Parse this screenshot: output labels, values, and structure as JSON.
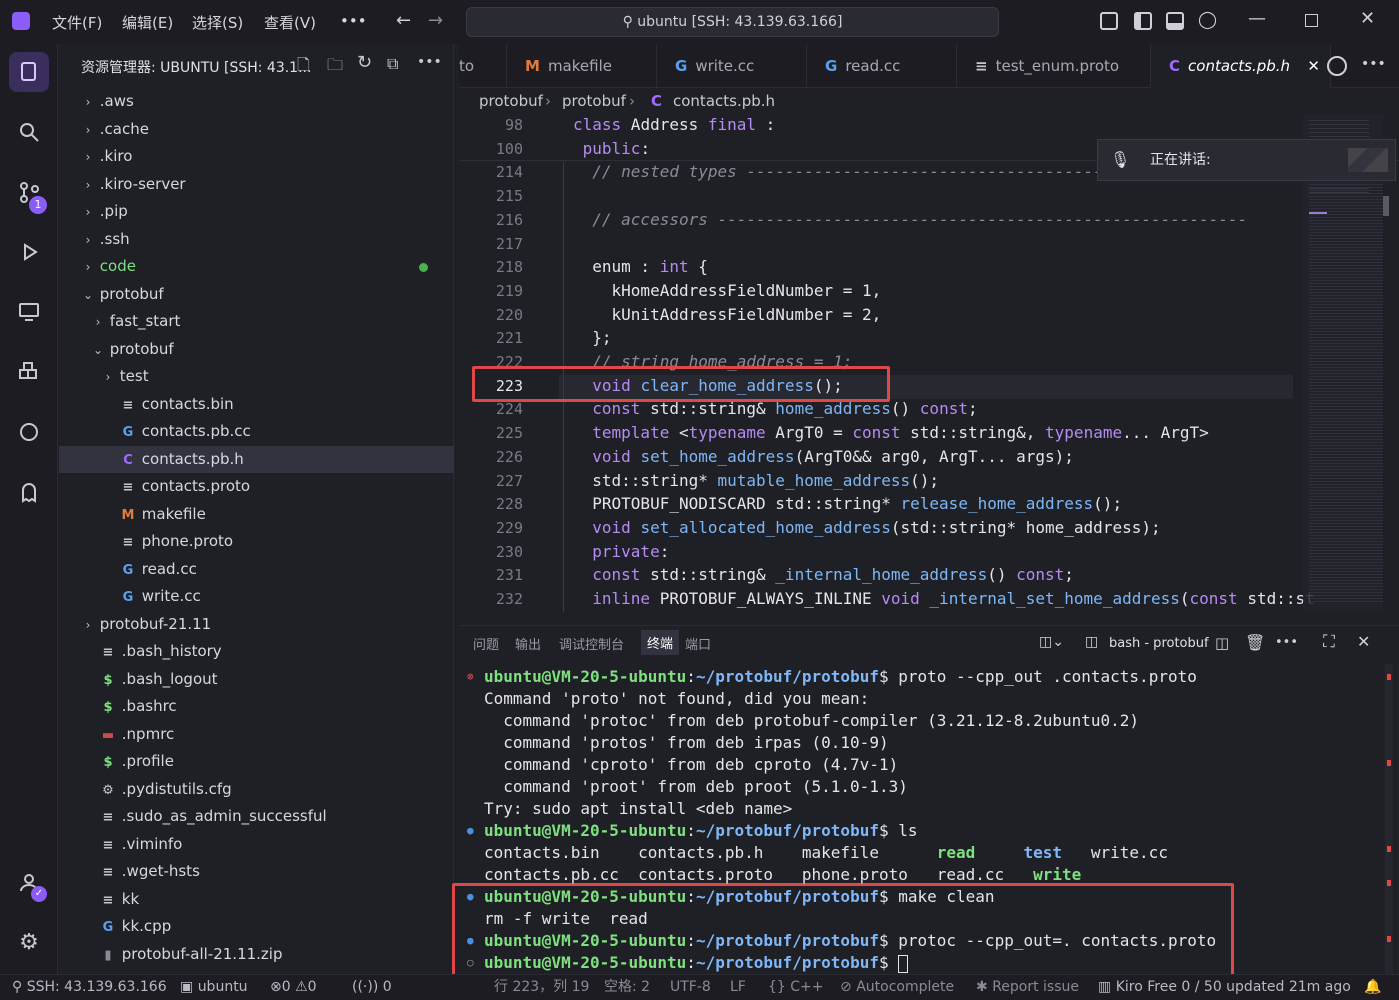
{
  "titlebar": {
    "menus": [
      "文件(F)",
      "编辑(E)",
      "选择(S)",
      "查看(V)",
      "•••"
    ],
    "command_center": "ubuntu [SSH: 43.139.63.166]"
  },
  "activity_badge": "1",
  "sidebar": {
    "title": "资源管理器: UBUNTU [SSH: 43.1...",
    "tree": [
      {
        "label": ".aws",
        "type": "folder",
        "depth": 0
      },
      {
        "label": ".cache",
        "type": "folder",
        "depth": 0
      },
      {
        "label": ".kiro",
        "type": "folder",
        "depth": 0
      },
      {
        "label": ".kiro-server",
        "type": "folder",
        "depth": 0
      },
      {
        "label": ".pip",
        "type": "folder",
        "depth": 0
      },
      {
        "label": ".ssh",
        "type": "folder",
        "depth": 0
      },
      {
        "label": "code",
        "type": "folder",
        "depth": 0,
        "modified": true
      },
      {
        "label": "protobuf",
        "type": "folder-open",
        "depth": 0
      },
      {
        "label": "fast_start",
        "type": "folder",
        "depth": 1
      },
      {
        "label": "protobuf",
        "type": "folder-open",
        "depth": 1
      },
      {
        "label": "test",
        "type": "folder",
        "depth": 2
      },
      {
        "label": "contacts.bin",
        "type": "text",
        "depth": 2
      },
      {
        "label": "contacts.pb.cc",
        "type": "cpp",
        "depth": 2
      },
      {
        "label": "contacts.pb.h",
        "type": "c",
        "depth": 2,
        "selected": true
      },
      {
        "label": "contacts.proto",
        "type": "text",
        "depth": 2
      },
      {
        "label": "makefile",
        "type": "make",
        "depth": 2
      },
      {
        "label": "phone.proto",
        "type": "text",
        "depth": 2
      },
      {
        "label": "read.cc",
        "type": "cpp",
        "depth": 2
      },
      {
        "label": "write.cc",
        "type": "cpp",
        "depth": 2
      },
      {
        "label": "protobuf-21.11",
        "type": "folder",
        "depth": 0
      },
      {
        "label": ".bash_history",
        "type": "text",
        "depth": 0
      },
      {
        "label": ".bash_logout",
        "type": "shell",
        "depth": 0
      },
      {
        "label": ".bashrc",
        "type": "shell",
        "depth": 0
      },
      {
        "label": ".npmrc",
        "type": "npm",
        "depth": 0
      },
      {
        "label": ".profile",
        "type": "shell",
        "depth": 0
      },
      {
        "label": ".pydistutils.cfg",
        "type": "gear",
        "depth": 0
      },
      {
        "label": ".sudo_as_admin_successful",
        "type": "text",
        "depth": 0
      },
      {
        "label": ".viminfo",
        "type": "text",
        "depth": 0
      },
      {
        "label": ".wget-hsts",
        "type": "text",
        "depth": 0
      },
      {
        "label": "kk",
        "type": "text",
        "depth": 0
      },
      {
        "label": "kk.cpp",
        "type": "cpp",
        "depth": 0
      },
      {
        "label": "protobuf-all-21.11.zip",
        "type": "zip",
        "depth": 0
      }
    ]
  },
  "tabs": [
    {
      "label": "to",
      "icon": ""
    },
    {
      "label": "makefile",
      "icon": "M"
    },
    {
      "label": "write.cc",
      "icon": "C+"
    },
    {
      "label": "read.cc",
      "icon": "C+"
    },
    {
      "label": "test_enum.proto",
      "icon": "≡"
    },
    {
      "label": "contacts.pb.h",
      "icon": "C",
      "active": true
    }
  ],
  "breadcrumb": [
    "protobuf",
    "protobuf",
    "contacts.pb.h"
  ],
  "editor": {
    "lines": [
      {
        "n": "98",
        "html": "<span class='kw'>class</span> Address <span class='kw'>final</span> :"
      },
      {
        "n": "100",
        "html": " <span class='kw'>public</span>:"
      },
      {
        "n": "214",
        "html": "  <span class='cm'>// nested types ----------------------------------------------------</span>"
      },
      {
        "n": "215",
        "html": ""
      },
      {
        "n": "216",
        "html": "  <span class='cm'>// accessors -------------------------------------------------------</span>"
      },
      {
        "n": "217",
        "html": ""
      },
      {
        "n": "218",
        "html": "  enum : <span class='ty'>int</span> {"
      },
      {
        "n": "219",
        "html": "    kHomeAddressFieldNumber = 1,"
      },
      {
        "n": "220",
        "html": "    kUnitAddressFieldNumber = 2,"
      },
      {
        "n": "221",
        "html": "  };"
      },
      {
        "n": "222",
        "html": "  <span class='cm'>// string home_address = 1;</span>"
      },
      {
        "n": "223",
        "html": "  <span class='ty'>void</span> <span class='fn'>clear_home_address</span>();"
      },
      {
        "n": "224",
        "html": "  <span class='kw'>const</span> std::string&amp; <span class='fn'>home_address</span>() <span class='kw'>const</span>;"
      },
      {
        "n": "225",
        "html": "  <span class='kw'>template</span> &lt;<span class='kw'>typename</span> ArgT0 = <span class='kw'>const</span> std::string&amp;, <span class='kw'>typename</span>... ArgT&gt;"
      },
      {
        "n": "226",
        "html": "  <span class='ty'>void</span> <span class='fn'>set_home_address</span>(ArgT0&amp;&amp; arg0, ArgT... args);"
      },
      {
        "n": "227",
        "html": "  std::string* <span class='fn'>mutable_home_address</span>();"
      },
      {
        "n": "228",
        "html": "  PROTOBUF_NODISCARD std::string* <span class='fn'>release_home_address</span>();"
      },
      {
        "n": "229",
        "html": "  <span class='ty'>void</span> <span class='fn'>set_allocated_home_address</span>(std::string* home_address);"
      },
      {
        "n": "230",
        "html": "  <span class='kw'>private</span>:"
      },
      {
        "n": "231",
        "html": "  <span class='kw'>const</span> std::string&amp; <span class='fn'>_internal_home_address</span>() <span class='kw'>const</span>;"
      },
      {
        "n": "232",
        "html": "  <span class='kw'>inline</span> PROTOBUF_ALWAYS_INLINE <span class='ty'>void</span> <span class='fn'>_internal_set_home_address</span>(<span class='kw'>const</span> std::st"
      }
    ],
    "current_line": "223"
  },
  "toast": {
    "text": "正在讲话:"
  },
  "panel": {
    "tabs": [
      "问题",
      "输出",
      "调试控制台",
      "终端",
      "端口"
    ],
    "active_tab": "终端",
    "terminal_name": "bash - protobuf"
  },
  "terminal": {
    "lines": [
      {
        "dot": "error",
        "html": "<span class='pr'>ubuntu@VM-20-5-ubuntu</span>:<span class='pa'>~/protobuf/protobuf</span>$ proto --cpp_out .contacts.proto"
      },
      {
        "dot": "",
        "html": "Command 'proto' not found, did you mean:"
      },
      {
        "dot": "",
        "html": "  command 'protoc' from deb protobuf-compiler (3.21.12-8.2ubuntu0.2)"
      },
      {
        "dot": "",
        "html": "  command 'protos' from deb irpas (0.10-9)"
      },
      {
        "dot": "",
        "html": "  command 'cproto' from deb cproto (4.7v-1)"
      },
      {
        "dot": "",
        "html": "  command 'proot' from deb proot (5.1.0-1.3)"
      },
      {
        "dot": "",
        "html": "Try: sudo apt install &lt;deb name&gt;"
      },
      {
        "dot": "ok",
        "html": "<span class='pr'>ubuntu@VM-20-5-ubuntu</span>:<span class='pa'>~/protobuf/protobuf</span>$ ls"
      },
      {
        "dot": "",
        "html": "contacts.bin    contacts.pb.h    makefile      <span class='bold-g'>read</span>     <span class='bold-b'>test</span>   write.cc"
      },
      {
        "dot": "",
        "html": "contacts.pb.cc  contacts.proto   phone.proto   read.cc   <span class='bold-g'>write</span>"
      },
      {
        "dot": "ok",
        "html": "<span class='pr'>ubuntu@VM-20-5-ubuntu</span>:<span class='pa'>~/protobuf/protobuf</span>$ make clean"
      },
      {
        "dot": "",
        "html": "rm -f write  read"
      },
      {
        "dot": "ok",
        "html": "<span class='pr'>ubuntu@VM-20-5-ubuntu</span>:<span class='pa'>~/protobuf/protobuf</span>$ protoc --cpp_out=. contacts.proto"
      },
      {
        "dot": "idle",
        "html": "<span class='pr'>ubuntu@VM-20-5-ubuntu</span>:<span class='pa'>~/protobuf/protobuf</span>$ <span style='display:inline-block;width:10px;height:18px;border:1px solid #e4e4ea;vertical-align:middle'></span>"
      }
    ]
  },
  "statusbar": {
    "remote": "SSH: 43.139.63.166",
    "user": "ubuntu",
    "errors": "0",
    "warnings": "0",
    "ports": "0",
    "position": "行 223，列 19",
    "spaces": "空格: 2",
    "encoding": "UTF-8",
    "eol": "LF",
    "language": "C++",
    "autocomplete": "Autocomplete",
    "report": "Report issue",
    "kiro": "Kiro Free 0 / 50 updated 21m ago"
  },
  "colors": {
    "accent": "#b58cf2",
    "highlight_box": "#e04848",
    "prompt": "#7ee07e",
    "path": "#7fb7f7"
  }
}
